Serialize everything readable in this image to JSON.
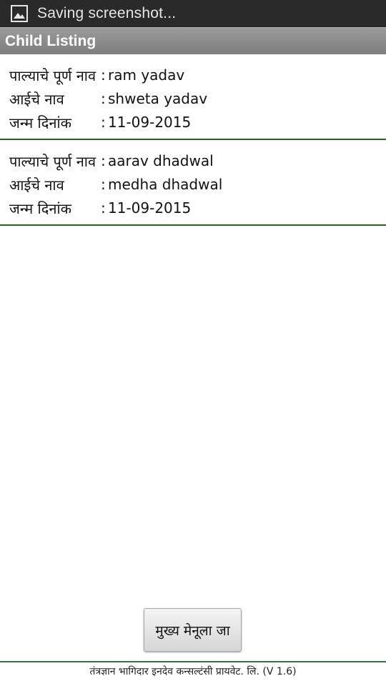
{
  "status_bar": {
    "icon": "image-icon",
    "text": "Saving screenshot..."
  },
  "title_bar": {
    "title": "Child Listing"
  },
  "children": [
    {
      "name_label": "पाल्याचे पूर्ण नाव",
      "name": "ram yadav",
      "mother_label": "आईचे नाव",
      "mother": "shweta yadav",
      "dob_label": "जन्म दिनांक",
      "dob": "11-09-2015"
    },
    {
      "name_label": "पाल्याचे पूर्ण नाव",
      "name": "aarav dhadwal",
      "mother_label": "आईचे नाव",
      "mother": "medha dhadwal",
      "dob_label": "जन्म दिनांक",
      "dob": "11-09-2015"
    }
  ],
  "separator": ":",
  "main_menu_button": "मुख्य मेनूला जा",
  "footer": "तंत्रज्ञान भागिदार इनदेव कन्सल्टंसी प्रायवेट. लि. (V 1.6)",
  "colors": {
    "status_bar_bg": "#2a2a2a",
    "title_bar_bg": "#8a8a8a",
    "divider": "#1e6b1e"
  }
}
